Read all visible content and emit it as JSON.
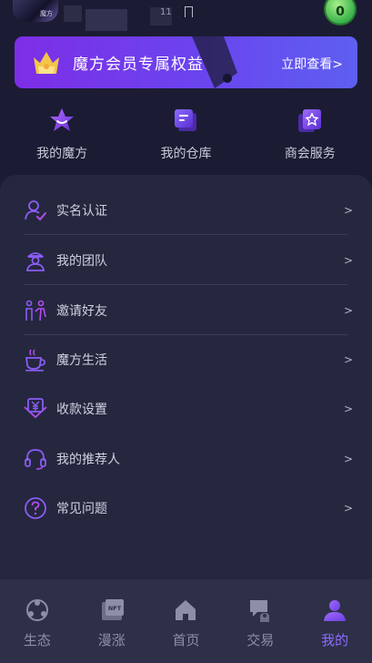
{
  "header": {
    "avatar_caption": "魔方",
    "status_mini": "11",
    "level_badge": "0"
  },
  "vip_banner": {
    "title": "魔方会员专属权益",
    "link": "立即查看>",
    "gradient_start": "#7d2ee6",
    "gradient_end": "#5e5ff0"
  },
  "quick_entries": [
    {
      "label": "我的魔方",
      "icon": "star-cube-icon"
    },
    {
      "label": "我的仓库",
      "icon": "warehouse-doc-icon"
    },
    {
      "label": "商会服务",
      "icon": "service-star-icon"
    }
  ],
  "menu": {
    "items": [
      {
        "label": "实名认证",
        "icon": "user-verified-icon",
        "arrow": ">"
      },
      {
        "label": "我的团队",
        "icon": "team-icon",
        "arrow": ">"
      },
      {
        "label": "邀请好友",
        "icon": "invite-friends-icon",
        "arrow": ">"
      },
      {
        "label": "魔方生活",
        "icon": "coffee-cup-icon",
        "arrow": ">"
      },
      {
        "label": "收款设置",
        "icon": "yuan-payment-icon",
        "arrow": ">"
      },
      {
        "label": "我的推荐人",
        "icon": "headset-icon",
        "arrow": ">"
      },
      {
        "label": "常见问题",
        "icon": "question-circle-icon",
        "arrow": ">"
      }
    ]
  },
  "tabbar": {
    "tabs": [
      {
        "label": "生态",
        "icon": "ecology-icon",
        "active": false
      },
      {
        "label": "漫涨",
        "icon": "nft-icon",
        "active": false,
        "icon_text": "NFT"
      },
      {
        "label": "首页",
        "icon": "home-icon",
        "active": false
      },
      {
        "label": "交易",
        "icon": "trade-icon",
        "active": false
      },
      {
        "label": "我的",
        "icon": "profile-icon",
        "active": true
      }
    ],
    "active_color": "#8d6bff",
    "inactive_color": "#8d8fa6"
  },
  "accent_color": "#8b3cf0"
}
